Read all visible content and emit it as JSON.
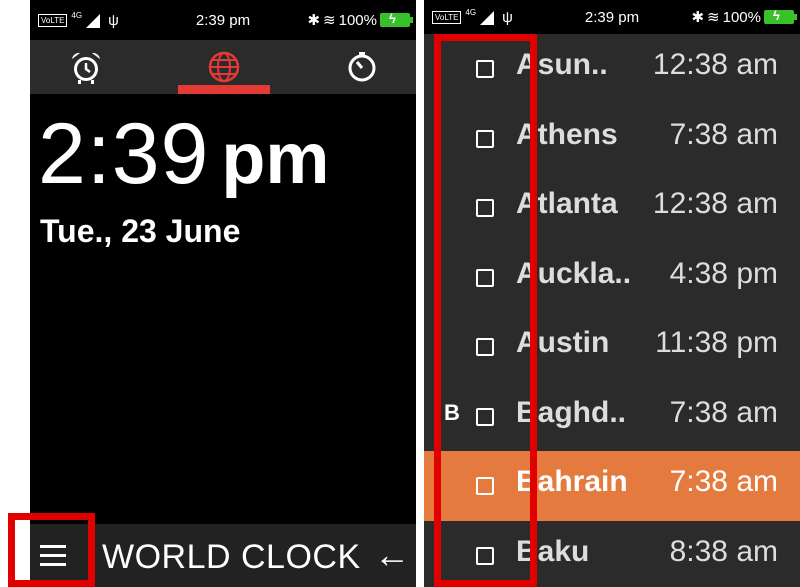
{
  "status_bar": {
    "time": "2:39 pm",
    "battery": "100%",
    "network": "4G",
    "volte": "VoLTE"
  },
  "tabs": [
    {
      "name": "alarm",
      "icon": "alarm-clock-icon"
    },
    {
      "name": "world-clock",
      "icon": "globe-icon",
      "active": true
    },
    {
      "name": "timer",
      "icon": "timer-icon"
    }
  ],
  "main": {
    "time": "2:39",
    "ampm": "pm",
    "date": "Tue., 23 June"
  },
  "bottom_bar": {
    "title": "WORLD CLOCK",
    "menu_icon": "hamburger-menu-icon",
    "back_icon": "back-arrow-icon"
  },
  "accent_colors": {
    "tab_underline": "#e53935",
    "highlight_row": "#e57a3e",
    "annotation": "#e00000",
    "battery": "#39c12b"
  },
  "cities": [
    {
      "name": "Asun..",
      "time": "12:38 am",
      "section": ""
    },
    {
      "name": "Athens",
      "time": "7:38 am",
      "section": ""
    },
    {
      "name": "Atlanta",
      "time": "12:38 am",
      "section": ""
    },
    {
      "name": "Auckla..",
      "time": "4:38 pm",
      "section": ""
    },
    {
      "name": "Austin",
      "time": "11:38 pm",
      "section": ""
    },
    {
      "name": "Baghd..",
      "time": "7:38 am",
      "section": "B"
    },
    {
      "name": "Bahrain",
      "time": "7:38 am",
      "section": "",
      "highlighted": true
    },
    {
      "name": "Baku",
      "time": "8:38 am",
      "section": ""
    }
  ]
}
